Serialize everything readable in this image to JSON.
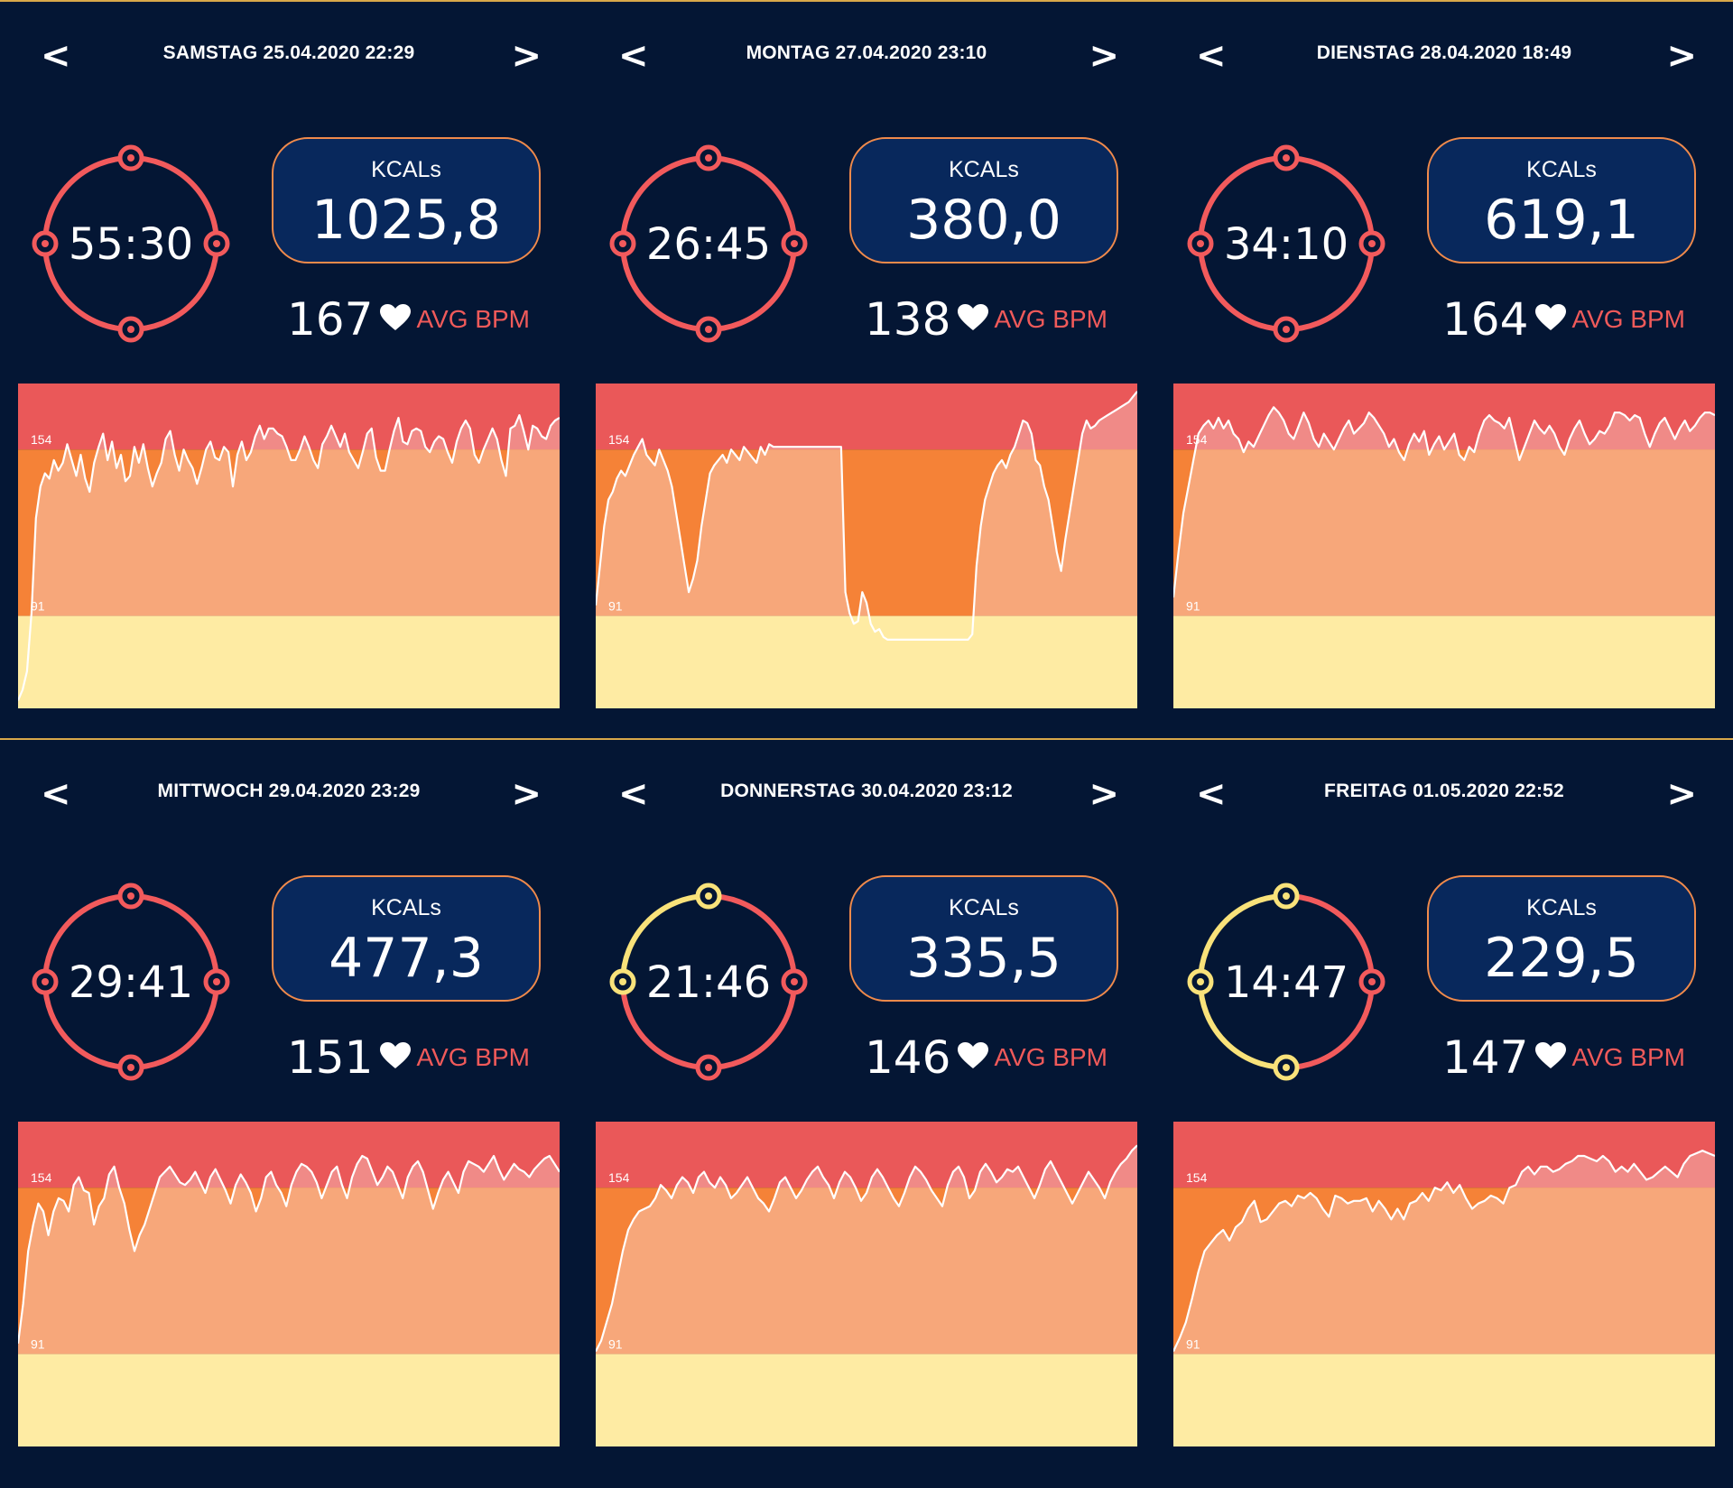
{
  "labels": {
    "kcal": "KCALs",
    "avg_bpm": "AVG BPM",
    "prev": "<",
    "next": ">"
  },
  "colors": {
    "background": "#041634",
    "zone_high": "#ea5859",
    "zone_mid": "#f58237",
    "zone_low": "#feeba3",
    "fill_above": "#f08a87",
    "fill_below": "#f7a77a",
    "ring_red": "#f25a5c",
    "ring_yellow": "#f9e27a",
    "kcal_box": "#08285c",
    "kcal_border": "#f08a4b"
  },
  "icons": {
    "heart": "heart-icon"
  },
  "workouts": [
    {
      "date": "SAMSTAG 25.04.2020 22:29",
      "duration": "55:30",
      "kcals": "1025,8",
      "avg_bpm": "167",
      "ring_progress": 1.0
    },
    {
      "date": "MONTAG 27.04.2020 23:10",
      "duration": "26:45",
      "kcals": "380,0",
      "avg_bpm": "138",
      "ring_progress": 1.0
    },
    {
      "date": "DIENSTAG 28.04.2020 18:49",
      "duration": "34:10",
      "kcals": "619,1",
      "avg_bpm": "164",
      "ring_progress": 1.0
    },
    {
      "date": "MITTWOCH 29.04.2020 23:29",
      "duration": "29:41",
      "kcals": "477,3",
      "avg_bpm": "151",
      "ring_progress": 1.0
    },
    {
      "date": "DONNERSTAG 30.04.2020 23:12",
      "duration": "21:46",
      "kcals": "335,5",
      "avg_bpm": "146",
      "ring_progress": 0.75
    },
    {
      "date": "FREITAG 01.05.2020 22:52",
      "duration": "14:47",
      "kcals": "229,5",
      "avg_bpm": "147",
      "ring_progress": 0.5
    }
  ],
  "chart_data": [
    {
      "type": "line",
      "y_ticks": [
        "154",
        "91"
      ],
      "ylim": [
        56,
        179
      ],
      "zones": [
        154,
        91
      ],
      "y": [
        59,
        63,
        70,
        92,
        128,
        140,
        145,
        143,
        150,
        146,
        149,
        156,
        150,
        144,
        152,
        143,
        138,
        149,
        155,
        160,
        150,
        157,
        147,
        152,
        142,
        144,
        155,
        149,
        156,
        147,
        140,
        145,
        149,
        158,
        161,
        152,
        146,
        154,
        150,
        147,
        141,
        147,
        154,
        157,
        151,
        150,
        155,
        153,
        140,
        152,
        157,
        150,
        153,
        159,
        163,
        158,
        162,
        162,
        160,
        159,
        155,
        150,
        150,
        154,
        159,
        155,
        150,
        147,
        156,
        159,
        163,
        159,
        155,
        160,
        153,
        150,
        147,
        153,
        160,
        162,
        151,
        146,
        146,
        154,
        161,
        166,
        157,
        156,
        161,
        162,
        161,
        155,
        153,
        157,
        159,
        158,
        153,
        149,
        157,
        162,
        165,
        162,
        152,
        149,
        154,
        158,
        162,
        158,
        150,
        144,
        162,
        163,
        167,
        161,
        154,
        163,
        162,
        159,
        158,
        163,
        165,
        166
      ]
    },
    {
      "type": "line",
      "y_ticks": [
        "154",
        "91"
      ],
      "ylim": [
        56,
        179
      ],
      "zones": [
        154,
        91
      ],
      "y": [
        95,
        110,
        125,
        135,
        138,
        143,
        146,
        144,
        148,
        152,
        155,
        158,
        152,
        150,
        148,
        154,
        150,
        146,
        140,
        130,
        120,
        110,
        100,
        105,
        112,
        125,
        135,
        145,
        148,
        150,
        152,
        149,
        154,
        152,
        150,
        155,
        153,
        151,
        149,
        155,
        152,
        156,
        155,
        155,
        155,
        155,
        155,
        155,
        155,
        155,
        155,
        155,
        155,
        155,
        155,
        155,
        155,
        155,
        155,
        100,
        92,
        88,
        89,
        100,
        96,
        88,
        85,
        86,
        83,
        82,
        82,
        82,
        82,
        82,
        82,
        82,
        82,
        82,
        82,
        82,
        82,
        82,
        82,
        82,
        82,
        82,
        82,
        82,
        82,
        84,
        110,
        125,
        135,
        140,
        145,
        148,
        150,
        147,
        152,
        155,
        160,
        165,
        164,
        160,
        150,
        148,
        140,
        135,
        125,
        115,
        108,
        120,
        130,
        140,
        150,
        160,
        165,
        162,
        163,
        165,
        166,
        167,
        168,
        169,
        170,
        171,
        172,
        174,
        176
      ]
    },
    {
      "type": "line",
      "y_ticks": [
        "154",
        "91"
      ],
      "ylim": [
        56,
        179
      ],
      "zones": [
        154,
        91
      ],
      "y": [
        98,
        115,
        130,
        140,
        150,
        160,
        163,
        165,
        162,
        166,
        162,
        165,
        160,
        158,
        153,
        157,
        155,
        159,
        163,
        167,
        170,
        168,
        165,
        160,
        158,
        163,
        168,
        164,
        158,
        155,
        160,
        157,
        154,
        158,
        162,
        165,
        160,
        162,
        164,
        168,
        166,
        163,
        160,
        155,
        158,
        153,
        150,
        156,
        160,
        157,
        161,
        152,
        156,
        159,
        154,
        157,
        160,
        152,
        150,
        155,
        153,
        160,
        165,
        167,
        165,
        164,
        162,
        166,
        158,
        150,
        155,
        160,
        165,
        162,
        160,
        163,
        160,
        155,
        152,
        158,
        162,
        165,
        160,
        156,
        158,
        161,
        160,
        163,
        168,
        168,
        167,
        165,
        167,
        166,
        160,
        155,
        160,
        164,
        166,
        162,
        158,
        162,
        165,
        161,
        163,
        166,
        168,
        168,
        167
      ]
    },
    {
      "type": "line",
      "y_ticks": [
        "154",
        "91"
      ],
      "ylim": [
        56,
        179
      ],
      "zones": [
        154,
        91
      ],
      "y": [
        95,
        110,
        130,
        140,
        148,
        145,
        136,
        145,
        150,
        149,
        145,
        155,
        158,
        153,
        152,
        140,
        147,
        150,
        159,
        162,
        154,
        148,
        138,
        130,
        136,
        140,
        146,
        152,
        158,
        160,
        162,
        159,
        156,
        155,
        157,
        160,
        156,
        152,
        158,
        161,
        157,
        153,
        148,
        155,
        159,
        156,
        152,
        145,
        150,
        158,
        160,
        155,
        152,
        147,
        155,
        160,
        163,
        162,
        160,
        156,
        150,
        155,
        160,
        162,
        155,
        150,
        158,
        163,
        166,
        165,
        160,
        155,
        158,
        162,
        160,
        155,
        150,
        158,
        162,
        164,
        160,
        153,
        146,
        152,
        157,
        160,
        156,
        152,
        160,
        164,
        163,
        162,
        160,
        163,
        166,
        161,
        157,
        160,
        163,
        161,
        160,
        158,
        161,
        163,
        165,
        166,
        163,
        160
      ]
    },
    {
      "type": "line",
      "y_ticks": [
        "154",
        "91"
      ],
      "ylim": [
        56,
        179
      ],
      "zones": [
        154,
        91
      ],
      "y": [
        92,
        96,
        103,
        110,
        120,
        130,
        138,
        142,
        145,
        146,
        147,
        150,
        155,
        153,
        150,
        155,
        158,
        156,
        152,
        158,
        160,
        156,
        154,
        158,
        155,
        150,
        152,
        155,
        158,
        154,
        150,
        148,
        145,
        150,
        156,
        158,
        154,
        150,
        153,
        157,
        160,
        162,
        158,
        155,
        150,
        156,
        160,
        158,
        154,
        149,
        152,
        158,
        161,
        158,
        154,
        150,
        147,
        152,
        158,
        162,
        160,
        157,
        153,
        150,
        147,
        155,
        160,
        162,
        158,
        150,
        153,
        160,
        163,
        160,
        156,
        158,
        161,
        160,
        162,
        158,
        154,
        150,
        155,
        161,
        164,
        160,
        156,
        152,
        148,
        152,
        156,
        160,
        157,
        154,
        150,
        156,
        160,
        163,
        165,
        168,
        170
      ]
    },
    {
      "type": "line",
      "y_ticks": [
        "154",
        "91"
      ],
      "ylim": [
        56,
        179
      ],
      "zones": [
        154,
        91
      ],
      "y": [
        92,
        97,
        103,
        112,
        122,
        130,
        133,
        136,
        138,
        134,
        139,
        141,
        146,
        149,
        141,
        142,
        145,
        148,
        149,
        147,
        151,
        150,
        152,
        150,
        146,
        143,
        151,
        150,
        148,
        149,
        149,
        150,
        145,
        149,
        146,
        142,
        146,
        142,
        148,
        149,
        152,
        149,
        154,
        153,
        156,
        152,
        155,
        150,
        146,
        148,
        149,
        151,
        150,
        148,
        154,
        155,
        160,
        162,
        159,
        162,
        162,
        160,
        161,
        163,
        164,
        166,
        166,
        165,
        164,
        166,
        164,
        160,
        162,
        160,
        163,
        160,
        157,
        158,
        160,
        162,
        160,
        158,
        163,
        166,
        167,
        168,
        167,
        166
      ]
    }
  ]
}
